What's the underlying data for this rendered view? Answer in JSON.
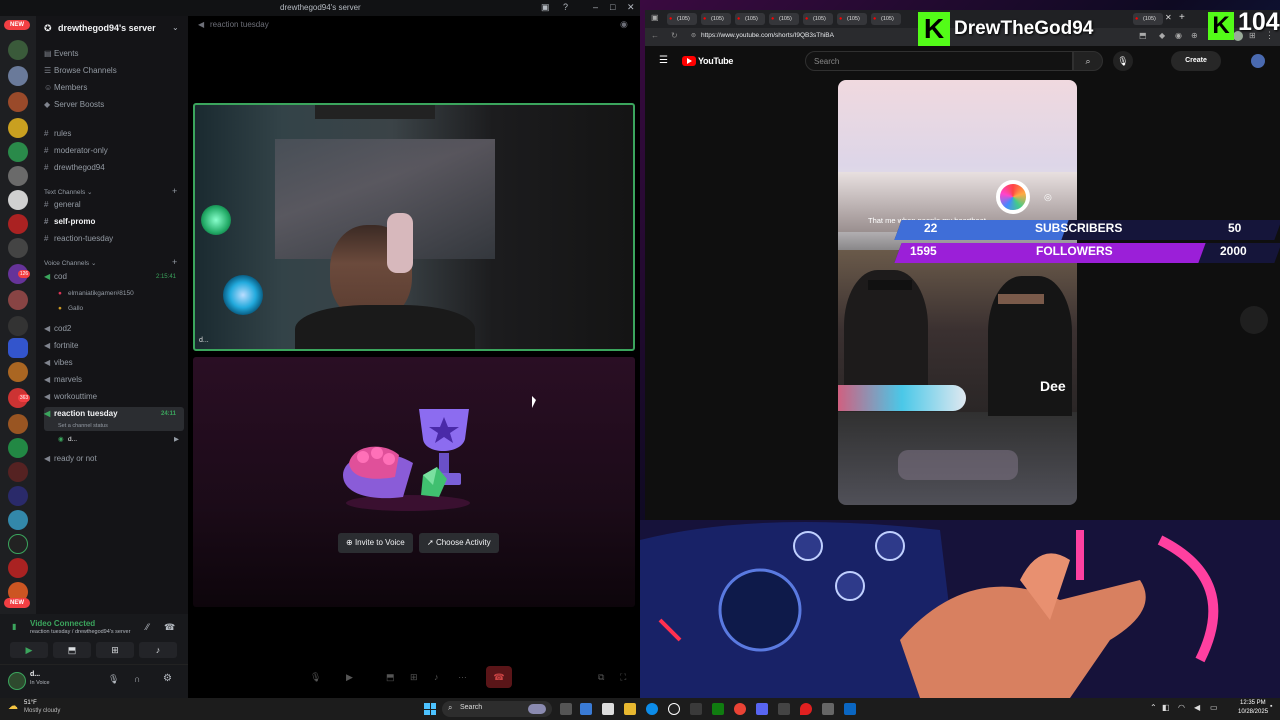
{
  "discord": {
    "window_title": "drewthegod94's server",
    "server_name": "drewthegod94's server",
    "guild_badge_new": "NEW",
    "guild_badges": [
      "1",
      "126",
      "363"
    ],
    "menu": [
      "Events",
      "Browse Channels",
      "Members",
      "Server Boosts"
    ],
    "top_channels": [
      "rules",
      "moderator-only",
      "drewthegod94"
    ],
    "text_category": "Text Channels",
    "text_channels": [
      "general",
      "self-promo",
      "reaction-tuesday"
    ],
    "voice_category": "Voice Channels",
    "voice_cod": "cod",
    "voice_cod_time": "2:15:41",
    "cod_users": [
      "elmaniatikgamer#8150",
      "Gallo"
    ],
    "voice_channels": [
      "cod2",
      "fortnite",
      "vibes",
      "marvels",
      "workouttime"
    ],
    "active_voice": "reaction tuesday",
    "active_voice_time": "24:11",
    "active_voice_status": "Set a channel status",
    "active_user": "d...",
    "last_voice": "ready or not",
    "channel_header": "reaction tuesday",
    "video_connected": "Video Connected",
    "video_connected_sub": "reaction tuesday / drewthegod94's server",
    "user_name": "d...",
    "user_status": "In Voice",
    "tile_label": "d...",
    "invite_label": "Invite to Voice",
    "activity_label": "Choose Activity"
  },
  "browser": {
    "url": "https://www.youtube.com/shorts/I9QB3sThiBA",
    "tab_label": "(105)"
  },
  "youtube": {
    "logo": "YouTube",
    "search_placeholder": "Search",
    "create_label": "Create",
    "short_caption": "That me when people my heartbeat",
    "short_name_tag": "Dee"
  },
  "overlay": {
    "streamer": "DrewTheGod94",
    "viewer_count": "104",
    "subscribers_label": "SUBSCRIBERS",
    "subscribers_current": "22",
    "subscribers_goal": "50",
    "subscribers_progress": 0.44,
    "followers_label": "FOLLOWERS",
    "followers_current": "1595",
    "followers_goal": "2000",
    "followers_progress": 0.8
  },
  "taskbar": {
    "weather_temp": "51°F",
    "weather_text": "Mostly cloudy",
    "search_label": "Search",
    "time": "12:35 PM",
    "date": "10/28/2025"
  },
  "colors": {
    "discord_green": "#3ba55d",
    "overlay_purple": "#9b1fd8",
    "overlay_blue": "#3f6ed8"
  }
}
